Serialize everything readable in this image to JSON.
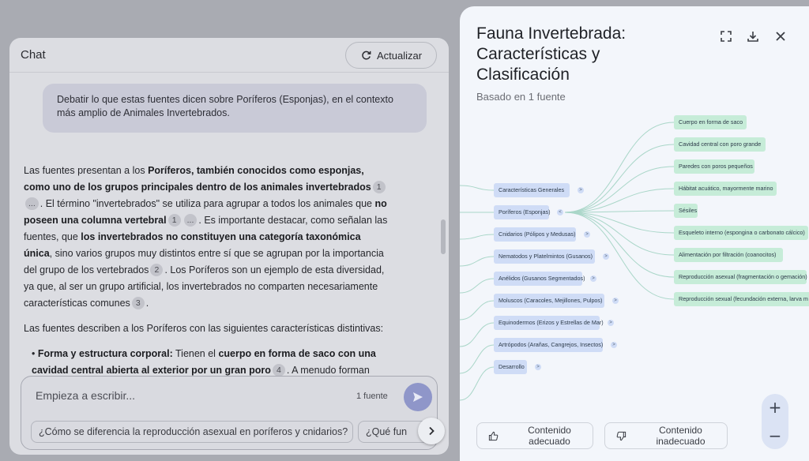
{
  "chat": {
    "title": "Chat",
    "refresh_label": "Actualizar",
    "user_message": "Debatir lo que estas fuentes dicen sobre Poríferos (Esponjas), en el contexto más amplio de Animales Invertebrados.",
    "response": {
      "p1": [
        {
          "t": "Las fuentes presentan a los "
        },
        {
          "b": "Poríferos, también conocidos como esponjas, como uno de los grupos principales dentro de los animales invertebrados"
        },
        {
          "c": "1"
        },
        {
          "c": "..."
        },
        {
          "t": ". El término \"invertebrados\" se utiliza para agrupar a todos los animales que "
        },
        {
          "b": "no poseen una columna vertebral"
        },
        {
          "c": "1"
        },
        {
          "c": "..."
        },
        {
          "t": ". Es importante destacar, como señalan las fuentes, que "
        },
        {
          "b": "los invertebrados no constituyen una categoría taxonómica única"
        },
        {
          "t": ", sino varios grupos muy distintos entre sí que se agrupan por la importancia del grupo de los vertebrados"
        },
        {
          "c": "2"
        },
        {
          "t": ". Los Poríferos son un ejemplo de esta diversidad, ya que, al ser un grupo artificial, los invertebrados no comparten necesariamente características comunes"
        },
        {
          "c": "3"
        },
        {
          "t": "."
        }
      ],
      "p2": "Las fuentes describen a los Poríferos con las siguientes características distintivas:",
      "bullet1": [
        {
          "b": "Forma y estructura corporal:"
        },
        {
          "t": " Tienen el "
        },
        {
          "b": "cuerpo en forma de saco con una cavidad central abierta al exterior por un gran poro"
        },
        {
          "c": "4"
        },
        {
          "t": ". A menudo forman"
        }
      ]
    },
    "composer": {
      "placeholder": "Empieza a escribir...",
      "source_count": "1 fuente",
      "suggestions": [
        "¿Cómo se diferencia la reproducción asexual en poríferos y cnidarios?",
        "¿Qué fun"
      ]
    }
  },
  "mindmap": {
    "title": "Fauna Invertebrada: Características y Clasificación",
    "subtitle": "Basado en 1 fuente",
    "branches": [
      "Características Generales",
      "Poríferos (Esponjas)",
      "Cnidarios (Pólipos y Medusas)",
      "Nematodos y Platelmintos (Gusanos)",
      "Anélidos (Gusanos Segmentados)",
      "Moluscos (Caracoles, Mejillones, Pulpos)",
      "Equinodermos (Erizos y Estrellas de Mar)",
      "Artrópodos (Arañas, Cangrejos, Insectos)",
      "Desarrollo"
    ],
    "porifera_children": [
      "Cuerpo en forma de saco",
      "Cavidad central con poro grande",
      "Paredes con poros pequeños",
      "Hábitat acuático, mayormente marino",
      "Sésiles",
      "Esqueleto interno (espongina o carbonato cálcico)",
      "Alimentación por filtración (coanocitos)",
      "Reproducción asexual (fragmentación o gemación)",
      "Reproducción sexual (fecundación externa, larva m"
    ],
    "expand_symbol": ">",
    "collapse_symbol": "<",
    "zoom_in": "+",
    "zoom_out": "−",
    "feedback_good": "Contenido adecuado",
    "feedback_bad": "Contenido inadecuado"
  },
  "colors": {
    "branch_node": "#cfdcf6",
    "leaf_node": "#c6ecd8",
    "connector": "#a9d6c8"
  }
}
